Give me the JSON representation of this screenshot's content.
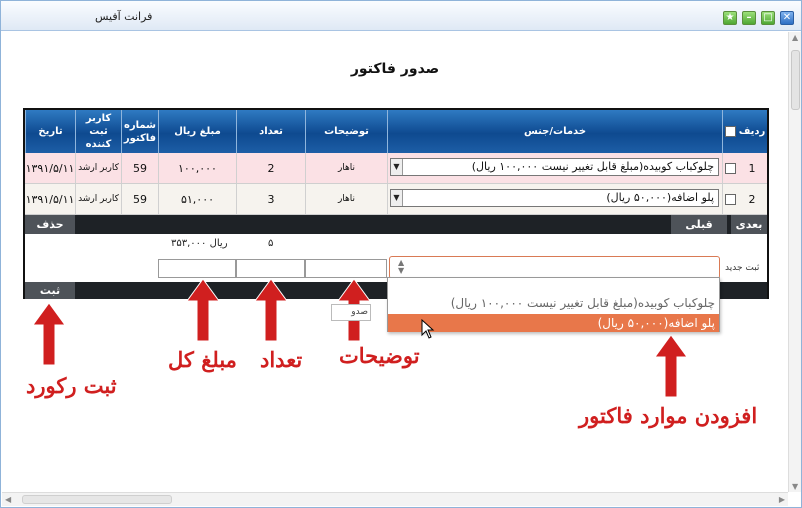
{
  "window": {
    "title": "فرانت آفیس"
  },
  "page": {
    "title": "صدور فاکتور"
  },
  "table": {
    "headers": {
      "row_no": "ردیف",
      "services": "خدمات/جنس",
      "description": "توضیحات",
      "quantity": "تعداد",
      "amount": "مبلغ ریال",
      "invoice_no": "شماره فاکتور",
      "user": "کاربر ثبت کننده",
      "date": "تاریخ"
    },
    "rows": [
      {
        "row_no": "1",
        "service": "چلوکباب کوبیده(مبلغ قابل تغییر نیست ۱۰۰,۰۰۰ ریال)",
        "description": "ناهار",
        "quantity": "2",
        "amount": "۱۰۰,۰۰۰",
        "invoice_no": "59",
        "user": "کاربر ارشد",
        "date": "۱۳۹۱/۵/۱۱"
      },
      {
        "row_no": "2",
        "service": "پلو اضافه(۵۰,۰۰۰ ریال)",
        "description": "ناهار",
        "quantity": "3",
        "amount": "۵۱,۰۰۰",
        "invoice_no": "59",
        "user": "کاربر ارشد",
        "date": "۱۳۹۱/۵/۱۱"
      }
    ],
    "nav": {
      "next": "بعدی",
      "prev": "قبلی",
      "delete": "حذف"
    },
    "totals": {
      "quantity": "۵",
      "amount": "۳۵۳,۰۰۰ ریال"
    },
    "new_row_label": "ثبت جدید",
    "save": "ثبت"
  },
  "dropdown": {
    "options": [
      "چلوکباب کوبیده(مبلغ قابل تغییر نیست ۱۰۰,۰۰۰ ریال)",
      "پلو اضافه(۵۰,۰۰۰ ریال)"
    ],
    "highlighted_index": 1,
    "behind_button": "صدو"
  },
  "annotations": {
    "save_record": "ثبت رکورد",
    "total_amount": "مبلغ کل",
    "quantity": "تعداد",
    "description": "توضیحات",
    "add_items": "افزودن موارد فاکتور"
  },
  "colors": {
    "header_blue": "#0e4a90",
    "row1": "#fbe1e5",
    "highlight": "#e8774a",
    "annotation_red": "#d01f1f"
  }
}
